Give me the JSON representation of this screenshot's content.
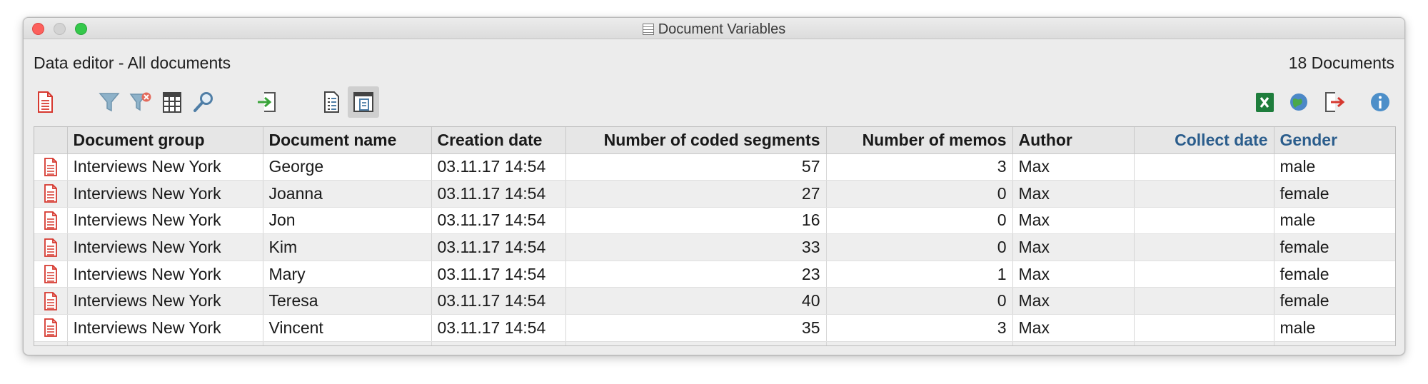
{
  "window": {
    "title": "Document Variables"
  },
  "header": {
    "left": "Data editor - All documents",
    "right": "18 Documents"
  },
  "toolbar": {
    "icons": [
      "document-icon",
      "filter-icon",
      "clear-filter-icon",
      "columns-icon",
      "search-icon",
      "import-icon",
      "list-view-icon",
      "grid-view-icon",
      "excel-icon",
      "web-export-icon",
      "export-icon",
      "info-icon"
    ]
  },
  "colors": {
    "accent_variable_header": "#2b5d8c",
    "doc_icon": "#d6382f",
    "close": "#fc605c",
    "maximize": "#34c84a"
  },
  "table": {
    "columns": [
      "",
      "Document group",
      "Document name",
      "Creation date",
      "Number of coded segments",
      "Number of memos",
      "Author",
      "Collect date",
      "Gender"
    ],
    "rows": [
      [
        "Interviews New York",
        "George",
        "03.11.17 14:54",
        "57",
        "3",
        "Max",
        "",
        "male"
      ],
      [
        "Interviews New York",
        "Joanna",
        "03.11.17 14:54",
        "27",
        "0",
        "Max",
        "",
        "female"
      ],
      [
        "Interviews New York",
        "Jon",
        "03.11.17 14:54",
        "16",
        "0",
        "Max",
        "",
        "male"
      ],
      [
        "Interviews New York",
        "Kim",
        "03.11.17 14:54",
        "33",
        "0",
        "Max",
        "",
        "female"
      ],
      [
        "Interviews New York",
        "Mary",
        "03.11.17 14:54",
        "23",
        "1",
        "Max",
        "",
        "female"
      ],
      [
        "Interviews New York",
        "Teresa",
        "03.11.17 14:54",
        "40",
        "0",
        "Max",
        "",
        "female"
      ],
      [
        "Interviews New York",
        "Vincent",
        "03.11.17 14:54",
        "35",
        "3",
        "Max",
        "",
        "male"
      ]
    ]
  }
}
